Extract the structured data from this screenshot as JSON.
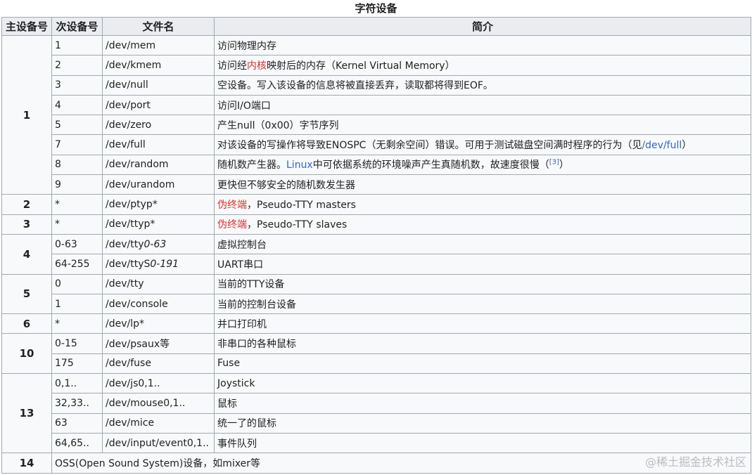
{
  "caption": "字符设备",
  "headers": [
    "主设备号",
    "次设备号",
    "文件名",
    "简介"
  ],
  "groups": [
    {
      "major": "1",
      "rows": [
        {
          "minor": "1",
          "file": [
            {
              "t": "/dev/mem"
            }
          ],
          "desc": [
            {
              "t": "访问物理内存"
            }
          ]
        },
        {
          "minor": "2",
          "file": [
            {
              "t": "/dev/kmem"
            }
          ],
          "desc": [
            {
              "t": "访问经"
            },
            {
              "t": "内核",
              "style": "link-red"
            },
            {
              "t": "映射后的内存（Kernel Virtual Memory）"
            }
          ]
        },
        {
          "minor": "3",
          "file": [
            {
              "t": "/dev/null"
            }
          ],
          "desc": [
            {
              "t": "空设备。写入该设备的信息将被直接丢弃，读取都将得到EOF。"
            }
          ]
        },
        {
          "minor": "4",
          "file": [
            {
              "t": "/dev/port"
            }
          ],
          "desc": [
            {
              "t": "访问I/O端口"
            }
          ]
        },
        {
          "minor": "5",
          "file": [
            {
              "t": "/dev/zero"
            }
          ],
          "desc": [
            {
              "t": "产生null（0x00）字节序列"
            }
          ]
        },
        {
          "minor": "7",
          "file": [
            {
              "t": "/dev/full"
            }
          ],
          "desc": [
            {
              "t": "对该设备的写操作将导致ENOSPC（无剩余空间）错误。可用于测试磁盘空间满时程序的行为（见"
            },
            {
              "t": "/dev/full",
              "style": "link-blue"
            },
            {
              "t": "）"
            }
          ]
        },
        {
          "minor": "8",
          "file": [
            {
              "t": "/dev/random"
            }
          ],
          "desc": [
            {
              "t": "随机数产生器。"
            },
            {
              "t": "Linux",
              "style": "link-blue"
            },
            {
              "t": "中可依据系统的环境噪声产生真随机数，故速度很慢（"
            },
            {
              "t": "[3]",
              "style": "link-blue",
              "sup": true
            },
            {
              "t": "）"
            }
          ]
        },
        {
          "minor": "9",
          "file": [
            {
              "t": "/dev/urandom"
            }
          ],
          "desc": [
            {
              "t": "更快但不够安全的随机数发生器"
            }
          ]
        }
      ]
    },
    {
      "major": "2",
      "rows": [
        {
          "minor": "*",
          "file": [
            {
              "t": "/dev/ptyp*"
            }
          ],
          "desc": [
            {
              "t": "伪终端",
              "style": "link-red"
            },
            {
              "t": "，Pseudo-TTY masters"
            }
          ]
        }
      ]
    },
    {
      "major": "3",
      "rows": [
        {
          "minor": "*",
          "file": [
            {
              "t": "/dev/ttyp*"
            }
          ],
          "desc": [
            {
              "t": "伪终端",
              "style": "link-red"
            },
            {
              "t": "，Pseudo-TTY slaves"
            }
          ]
        }
      ]
    },
    {
      "major": "4",
      "rows": [
        {
          "minor": "0-63",
          "file": [
            {
              "t": "/dev/tty"
            },
            {
              "t": "0-63",
              "style": "it"
            }
          ],
          "desc": [
            {
              "t": "虚拟控制台"
            }
          ]
        },
        {
          "minor": "64-255",
          "file": [
            {
              "t": "/dev/ttyS"
            },
            {
              "t": "0-191",
              "style": "it"
            }
          ],
          "desc": [
            {
              "t": "UART串口"
            }
          ]
        }
      ]
    },
    {
      "major": "5",
      "rows": [
        {
          "minor": "0",
          "file": [
            {
              "t": "/dev/tty"
            }
          ],
          "desc": [
            {
              "t": "当前的TTY设备"
            }
          ]
        },
        {
          "minor": "1",
          "file": [
            {
              "t": "/dev/console"
            }
          ],
          "desc": [
            {
              "t": "当前的控制台设备"
            }
          ]
        }
      ]
    },
    {
      "major": "6",
      "rows": [
        {
          "minor": "*",
          "file": [
            {
              "t": "/dev/lp*"
            }
          ],
          "desc": [
            {
              "t": "并口打印机"
            }
          ]
        }
      ]
    },
    {
      "major": "10",
      "rows": [
        {
          "minor": "0-15",
          "file": [
            {
              "t": "/dev/psaux等"
            }
          ],
          "desc": [
            {
              "t": "非串口的各种鼠标"
            }
          ]
        },
        {
          "minor": "175",
          "file": [
            {
              "t": "/dev/fuse"
            }
          ],
          "desc": [
            {
              "t": "Fuse"
            }
          ]
        }
      ]
    },
    {
      "major": "13",
      "rows": [
        {
          "minor": "0,1..",
          "file": [
            {
              "t": "/dev/js0,1.."
            }
          ],
          "desc": [
            {
              "t": "Joystick"
            }
          ]
        },
        {
          "minor": "32,33..",
          "file": [
            {
              "t": "/dev/mouse0,1.."
            }
          ],
          "desc": [
            {
              "t": "鼠标"
            }
          ]
        },
        {
          "minor": "63",
          "file": [
            {
              "t": "/dev/mice"
            }
          ],
          "desc": [
            {
              "t": "统一了的鼠标"
            }
          ]
        },
        {
          "minor": "64,65..",
          "file": [
            {
              "t": "/dev/input/event0,1.."
            }
          ],
          "desc": [
            {
              "t": "事件队列"
            }
          ]
        }
      ]
    },
    {
      "major": "14",
      "span": "OSS(Open Sound System)设备，如mixer等"
    }
  ],
  "watermark": "@稀土掘金技术社区"
}
